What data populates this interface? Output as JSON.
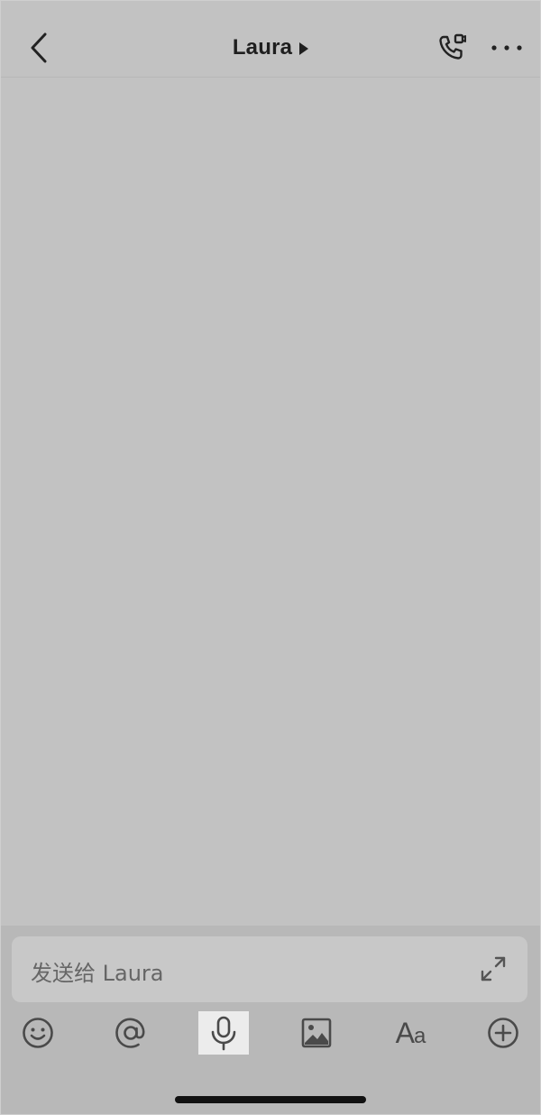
{
  "header": {
    "title": "Laura",
    "back_icon": "chevron-left-icon",
    "caret_icon": "caret-right-icon",
    "call_icon": "phone-video-icon",
    "more_icon": "more-horizontal-icon"
  },
  "composer": {
    "placeholder": "发送给 Laura",
    "expand_icon": "expand-icon"
  },
  "toolbar": {
    "items": [
      {
        "name": "emoji",
        "icon": "smiley-icon"
      },
      {
        "name": "mention",
        "icon": "at-sign-icon"
      },
      {
        "name": "voice",
        "icon": "microphone-icon",
        "active": true
      },
      {
        "name": "image",
        "icon": "image-icon"
      },
      {
        "name": "text-format",
        "icon": "text-format-icon",
        "label_big": "A",
        "label_small": "a"
      },
      {
        "name": "more",
        "icon": "plus-circle-icon"
      }
    ]
  },
  "colors": {
    "background": "#c2c2c2",
    "composer_bg": "#b8b8b8",
    "input_bg": "#c8c8c8",
    "icon": "#4a4a4a",
    "title": "#1f1f1f",
    "active_tool_bg": "#ececec"
  }
}
